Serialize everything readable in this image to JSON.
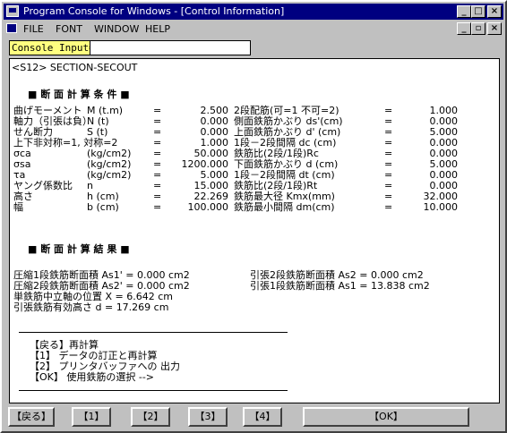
{
  "window": {
    "title": "Program Console for Windows - [Control Information]",
    "title_controls": [
      "_",
      "□",
      "×"
    ],
    "mdi_controls": [
      "_",
      "▫",
      "×"
    ]
  },
  "menu": {
    "items": [
      "FILE",
      "FONT",
      "WINDOW",
      "HELP"
    ]
  },
  "console": {
    "label": "Console Input=",
    "value": ""
  },
  "output": {
    "header": "<S12>    SECTION-SECOUT",
    "cond_title": "■ 断 面 計 算 条 件 ■",
    "cond_left": [
      {
        "label": "曲げモーメント",
        "unit": "M (t.m)",
        "eq": "=",
        "value": "2.500"
      },
      {
        "label": "軸力（引張は負）",
        "unit": "N (t)",
        "eq": "=",
        "value": "0.000"
      },
      {
        "label": "せん断力",
        "unit": "S (t)",
        "eq": "=",
        "value": "0.000"
      },
      {
        "label": "上下非対称=1, 対称=2",
        "unit": "",
        "eq": "=",
        "value": "1.000"
      },
      {
        "label": "σca",
        "unit": "(kg/cm2)",
        "eq": "=",
        "value": "50.000"
      },
      {
        "label": "σsa",
        "unit": "(kg/cm2)",
        "eq": "=",
        "value": "1200.000"
      },
      {
        "label": "τa",
        "unit": "(kg/cm2)",
        "eq": "=",
        "value": "5.000"
      },
      {
        "label": "ヤング係数比",
        "unit": "n",
        "eq": "=",
        "value": "15.000"
      },
      {
        "label": "高さ",
        "unit": "h (cm)",
        "eq": "=",
        "value": "22.269"
      },
      {
        "label": "幅",
        "unit": "b (cm)",
        "eq": "=",
        "value": "100.000"
      }
    ],
    "cond_right": [
      {
        "label": "2段配筋(可=1 不可=2)",
        "eq": "=",
        "value": "1.000"
      },
      {
        "label": "側面鉄筋かぶり  ds'(cm)",
        "eq": "=",
        "value": "0.000"
      },
      {
        "label": "上面鉄筋かぶり  d' (cm)",
        "eq": "=",
        "value": "5.000"
      },
      {
        "label": "1段－2段間隔  dc (cm)",
        "eq": "=",
        "value": "0.000"
      },
      {
        "label": "鉄筋比(2段/1段)Rc",
        "eq": "=",
        "value": "0.000"
      },
      {
        "label": "下面鉄筋かぶり  d (cm)",
        "eq": "=",
        "value": "5.000"
      },
      {
        "label": "1段－2段間隔  dt (cm)",
        "eq": "=",
        "value": "0.000"
      },
      {
        "label": "鉄筋比(2段/1段)Rt",
        "eq": "=",
        "value": "0.000"
      },
      {
        "label": "鉄筋最大径     Kmx(mm)",
        "eq": "=",
        "value": "32.000"
      },
      {
        "label": "鉄筋最小間隔   dm(cm)",
        "eq": "=",
        "value": "10.000"
      }
    ],
    "result_title": "■ 断 面 計 算 結 果 ■",
    "results": [
      "圧縮1段鉄筋断面積  As1' =  0.000 cm2",
      "圧縮2段鉄筋断面積  As2' =  0.000 cm2",
      "単鉄筋中立軸の位置    X =  6.642 cm",
      "引張鉄筋有効高さ      d = 17.269 cm"
    ],
    "results_right": [
      "引張2段鉄筋断面積  As2  =  0.000 cm2",
      "引張1段鉄筋断面積  As1  = 13.838 cm2"
    ],
    "menu_options": [
      "【戻る】再計算",
      "【1】  データの訂正と再計算",
      "【2】  プリンタバッファへの 出力",
      "【OK】  使用鉄筋の選択 -->"
    ]
  },
  "function_keys": [
    "【戻る】",
    "【1】",
    "【2】",
    "【3】",
    "【4】",
    "【OK】"
  ],
  "colors": {
    "titlebar": "#000080",
    "console_label_bg": "#ffff80",
    "desktop": "#2f8f8f"
  }
}
